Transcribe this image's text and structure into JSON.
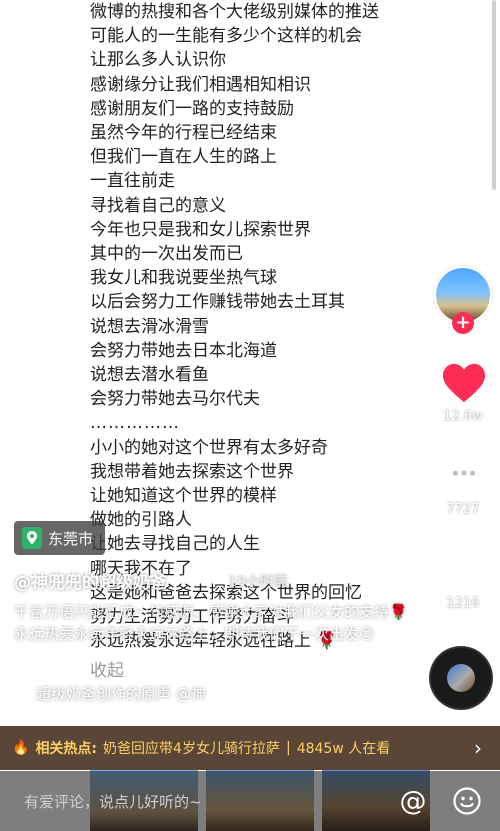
{
  "article": {
    "lines": [
      "微博的热搜和各个大佬级别媒体的推送",
      "可能人的一生能有多少个这样的机会",
      "让那么多人认识你",
      "感谢缘分让我们相遇相知相识",
      "感谢朋友们一路的支持鼓励",
      "虽然今年的行程已经结束",
      "但我们一直在人生的路上",
      "一直往前走",
      "寻找着自己的意义",
      "今年也只是我和女儿探索世界",
      "其中的一次出发而已",
      "我女儿和我说要坐热气球",
      "以后会努力工作赚钱带她去土耳其",
      "说想去滑冰滑雪",
      "会努力带她去日本北海道",
      "说想去潜水看鱼",
      "会努力带她去马尔代夫",
      "……………",
      "小小的她对这个世界有太多好奇",
      "我想带着她去探索这个世界",
      "让她知道这个世界的模样",
      "做她的引路人",
      "让她去寻找自己的人生",
      "哪天我不在了",
      "这是她和爸爸去探索这个世界的回忆",
      "努力生活努力工作努力奋斗",
      "永远热爱永远年轻永远在路上 🌹"
    ],
    "fold_label": "收起"
  },
  "location": {
    "icon": "location-pin-icon",
    "label": "东莞市"
  },
  "author": {
    "name": "@神兜兜的超级奶爸",
    "time": "10小时前"
  },
  "caption": "千言万语只能汇成一句感谢，感谢大家对我们父女的支持🌹永远热爱永远年轻永远在路上，期待我们下一次出发😊",
  "music": {
    "icon": "tiktok-note-icon",
    "text": "超级奶爸创作的原声 @神"
  },
  "actions": {
    "like_count": "12.6w",
    "comment_count": "7727",
    "share_count": "1216"
  },
  "hot": {
    "label": "相关热点:",
    "topic": "奶爸回应带4岁女儿骑行拉萨",
    "viewers": "4845w 人在看"
  },
  "comment": {
    "placeholder": "有爱评论，说点儿好听的~"
  },
  "colors": {
    "like": "#fe2c55",
    "hot_bg": "#5a4636",
    "hot_text": "#ffcf64"
  }
}
